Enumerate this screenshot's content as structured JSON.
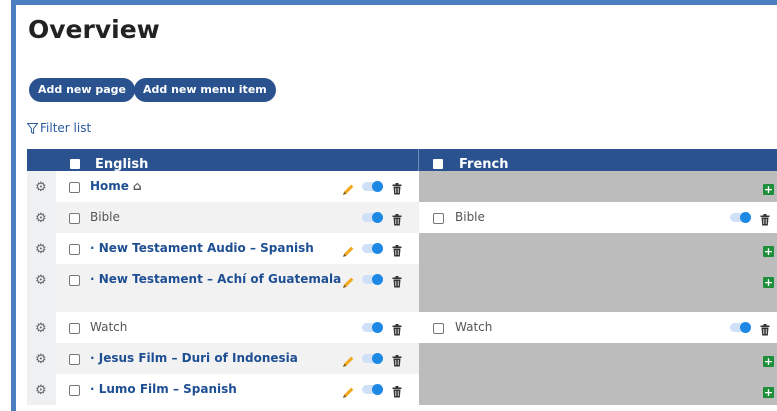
{
  "page": {
    "title": "Overview"
  },
  "toolbar": {
    "add_page_label": "Add new page",
    "add_menu_item_label": "Add new menu item"
  },
  "filter": {
    "label": "Filter list"
  },
  "table": {
    "headers": {
      "english": "English",
      "french": "French"
    },
    "rows": [
      {
        "en_label": "Home",
        "en_link": true,
        "en_home_icon": true,
        "en_edit": true,
        "fr_label": null
      },
      {
        "en_label": "Bible",
        "en_link": false,
        "en_edit": false,
        "fr_label": "Bible"
      },
      {
        "en_label": "· New Testament Audio – Spanish",
        "en_link": true,
        "en_edit": true,
        "fr_label": null
      },
      {
        "en_label": "· New Testament – Achí of Guatemala",
        "en_link": true,
        "en_edit": true,
        "fr_label": null
      },
      {
        "en_label": "Watch",
        "en_link": false,
        "en_edit": false,
        "fr_label": "Watch"
      },
      {
        "en_label": "· Jesus Film – Duri of Indonesia",
        "en_link": true,
        "en_edit": true,
        "fr_label": null
      },
      {
        "en_label": "· Lumo Film – Spanish",
        "en_link": true,
        "en_edit": true,
        "fr_label": null
      }
    ]
  },
  "colors": {
    "header": "#29528f",
    "accent": "#1e88e5",
    "missing_translation": "#bcbcbc",
    "add_translation": "#1f8e3a"
  },
  "icons": {
    "settings": "gear-icon",
    "home": "home-icon",
    "edit": "pencil-icon",
    "toggle": "toggle-switch",
    "delete": "trash-icon",
    "add": "plus-icon",
    "filter": "filter-icon"
  }
}
